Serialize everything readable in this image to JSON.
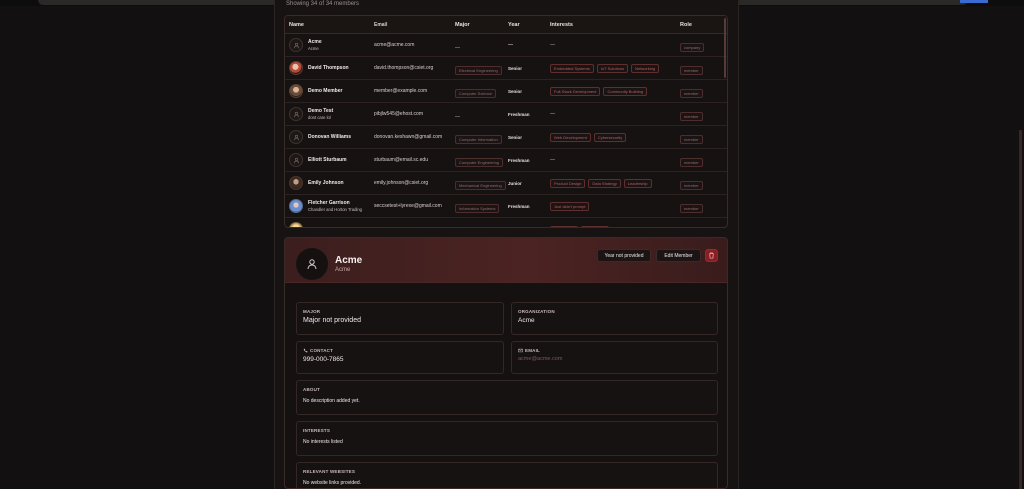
{
  "header": {
    "showing": "Showing 34 of 34 members"
  },
  "table": {
    "columns": [
      "Name",
      "Email",
      "Major",
      "Year",
      "Interests",
      "Role"
    ],
    "rows": [
      {
        "name": "Acme",
        "sub": "Acme",
        "email": "acme@acme.com",
        "major": "—",
        "year": "—",
        "interests": [
          "—"
        ],
        "role": "company",
        "avatar": "placeholder"
      },
      {
        "name": "David Thompson",
        "sub": "",
        "email": "david.thompson@csiet.org",
        "major": "Electrical Engineering",
        "year": "Senior",
        "interests": [
          "Embedded Systems",
          "IoT Solutions",
          "Networking"
        ],
        "role": "member",
        "avatar": "photo1"
      },
      {
        "name": "Demo Member",
        "sub": "",
        "email": "member@example.com",
        "major": "Computer Science",
        "year": "Senior",
        "interests": [
          "Full-Stack Development",
          "Community Building"
        ],
        "role": "member",
        "avatar": "photo2"
      },
      {
        "name": "Demo Test",
        "sub": "dont care lol",
        "email": "pibjlw545@ehost.com",
        "major": "—",
        "year": "Freshman",
        "interests": [
          "—"
        ],
        "role": "member",
        "avatar": "placeholder"
      },
      {
        "name": "Donovan Williams",
        "sub": "",
        "email": "donovan.keshawn@gmail.com",
        "major": "Computer Information",
        "year": "Senior",
        "interests": [
          "Web Development",
          "Cybersecurity"
        ],
        "role": "member",
        "avatar": "placeholder"
      },
      {
        "name": "Elliott Sturbaum",
        "sub": "",
        "email": "sturbaum@email.sc.edu",
        "major": "Computer Engineering",
        "year": "Freshman",
        "interests": [
          "—"
        ],
        "role": "member",
        "avatar": "placeholder"
      },
      {
        "name": "Emily Johnson",
        "sub": "",
        "email": "emily.johnson@csiet.org",
        "major": "Mechanical Engineering",
        "year": "Junior",
        "interests": [
          "Product Design",
          "Data Strategy",
          "Leadership"
        ],
        "role": "member",
        "avatar": "photo3"
      },
      {
        "name": "Fletcher Garrison",
        "sub": "Chandler and Horton Trading",
        "email": "seccsetest+lyrexe@gmail.com",
        "major": "Information Systems",
        "year": "Freshman",
        "interests": [
          "Just didn't prompt"
        ],
        "role": "member",
        "avatar": "photo4"
      },
      {
        "name": "",
        "sub": "",
        "email": "",
        "major": "",
        "year": "",
        "interests": [
          "",
          ""
        ],
        "role": "",
        "avatar": "photo5"
      }
    ]
  },
  "detail": {
    "name": "Acme",
    "subtitle": "Acme",
    "year_button": "Year not provided",
    "edit_button": "Edit Member",
    "fields": {
      "major_label": "MAJOR",
      "major_value": "Major not provided",
      "org_label": "ORGANIZATION",
      "org_value": "Acme",
      "contact_label": "CONTACT",
      "contact_value": "999-000-7865",
      "email_label": "EMAIL",
      "email_value": "acme@acme.com",
      "about_label": "ABOUT",
      "about_value": "No description added yet.",
      "interests_label": "INTERESTS",
      "interests_value": "No interests listed",
      "websites_label": "RELEVANT WEBSITES",
      "websites_value": "No website links provided."
    }
  },
  "colors": {
    "accent": "#4b2322",
    "danger": "#8a1f22",
    "background": "#121010"
  }
}
